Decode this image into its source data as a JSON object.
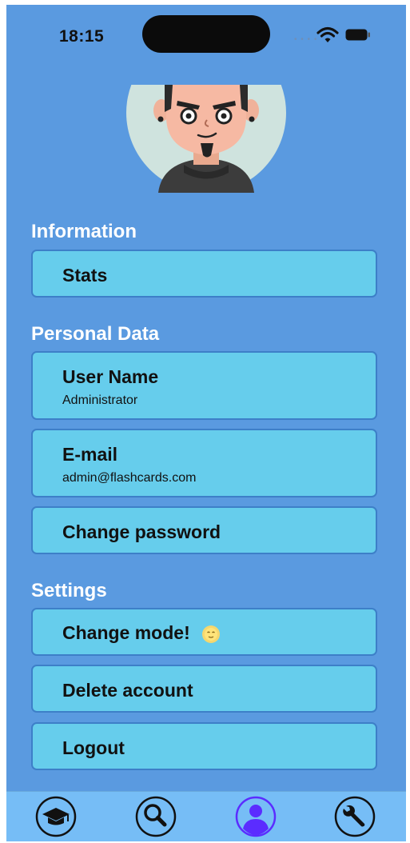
{
  "status": {
    "time": "18:15"
  },
  "sections": {
    "information": "Information",
    "personal": "Personal Data",
    "settings": "Settings"
  },
  "cards": {
    "stats": "Stats",
    "username_title": "User Name",
    "username_value": "Administrator",
    "email_title": "E-mail",
    "email_value": "admin@flashcards.com",
    "change_password": "Change password",
    "change_mode": "Change mode!",
    "delete_account": "Delete account",
    "logout": "Logout"
  },
  "icons": {
    "mode": "sun-face-icon",
    "tab1": "graduation-cap-icon",
    "tab2": "search-icon",
    "tab3": "profile-icon",
    "tab4": "wrench-icon"
  },
  "colors": {
    "background": "#5a9ae0",
    "card": "#66cdec",
    "card_border": "#3d7fc8",
    "tabbar": "#76bdf6",
    "active_tab": "#5b2cff"
  },
  "tabs": {
    "active_index": 2
  }
}
